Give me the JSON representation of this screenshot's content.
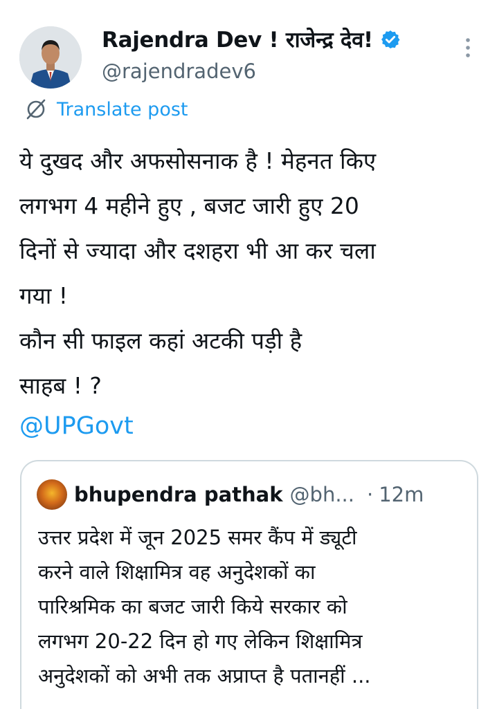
{
  "author": {
    "display_name": "Rajendra Dev ! राजेन्द्र देव!",
    "handle": "@rajendradev6",
    "verified": true
  },
  "translate_label": "Translate post",
  "post_lines": [
    "ये दुखद और अफसोसनाक है ! मेहनत किए",
    "लगभग 4 महीने हुए , बजट जारी हुए 20",
    "दिनों से ज्यादा और दशहरा भी आ कर चला",
    "गया !",
    "कौन सी फाइल कहां अटकी पड़ी है",
    "साहब ! ?"
  ],
  "mention": "@UPGovt",
  "quoted_post": {
    "name": "bhupendra pathak",
    "handle": "@bh...",
    "separator": "·",
    "time": "12m",
    "lines": [
      "उत्तर प्रदेश में जून 2025 समर कैंप में ड्यूटी",
      "करने वाले शिक्षामित्र वह अनुदेशकों का",
      "पारिश्रमिक का बजट जारी किये सरकार को",
      "लगभग 20-22 दिन हो गए लेकिन शिक्षामित्र",
      "अनुदेशकों को अभी तक अप्राप्त है पतानहीं ..."
    ]
  },
  "icons": {
    "verified": "verified-badge-icon",
    "more": "more-vertical-icon",
    "translate": "translate-globe-icon"
  },
  "colors": {
    "accent": "#1d9bf0",
    "text": "#0f1419",
    "secondary": "#536471",
    "border": "#cfd9de"
  }
}
